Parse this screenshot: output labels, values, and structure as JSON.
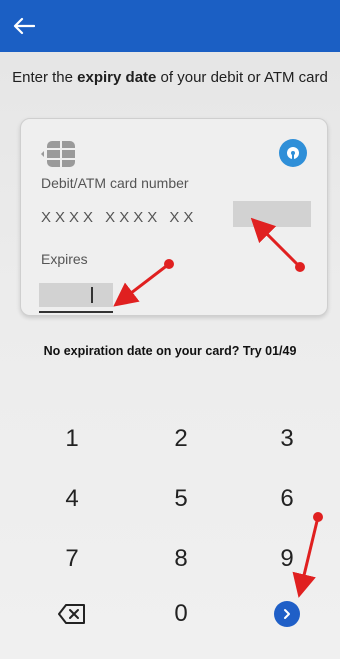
{
  "header": {
    "back_icon": "arrow-left-icon"
  },
  "prompt": {
    "prefix": "Enter the ",
    "bold": "expiry date",
    "suffix": " of your debit or ATM card"
  },
  "card": {
    "chip_icon": "card-chip-icon",
    "logo_icon": "bank-logo-icon",
    "number_label": "Debit/ATM card number",
    "number_masked": "XXXX XXXX XX",
    "expires_label": "Expires"
  },
  "hint": "No expiration date on your card? Try 01/49",
  "keypad": {
    "keys": [
      "1",
      "2",
      "3",
      "4",
      "5",
      "6",
      "7",
      "8",
      "9",
      "",
      "0",
      ""
    ],
    "backspace_icon": "backspace-icon",
    "next_icon": "chevron-right-icon"
  },
  "colors": {
    "appbar": "#1b5fc4",
    "primary_button": "#1f5fc7",
    "annotation_arrow": "#e02020"
  }
}
